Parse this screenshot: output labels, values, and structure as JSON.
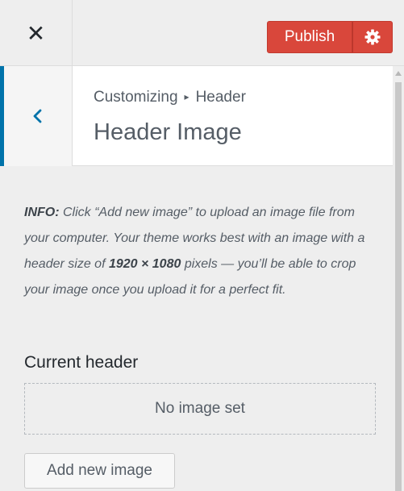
{
  "topbar": {
    "close_icon": "close-icon",
    "close_glyph": "✕",
    "publish_label": "Publish",
    "settings_icon": "gear-icon",
    "publish_color": "#d9473b"
  },
  "section": {
    "breadcrumb_parent": "Customizing",
    "breadcrumb_sep": "▸",
    "breadcrumb_current": "Header",
    "title": "Header Image",
    "back_icon": "chevron-left-icon",
    "accent_color": "#0073aa"
  },
  "info": {
    "label": "INFO:",
    "text_1": " Click “Add new image” to upload an image file from your computer. Your theme works best with an image with a header size of ",
    "size": "1920 × 1080",
    "text_2": " pixels — you’ll be able to crop your image once you upload it for a perfect fit."
  },
  "current_header": {
    "label": "Current header",
    "placeholder": "No image set",
    "add_button": "Add new image"
  }
}
